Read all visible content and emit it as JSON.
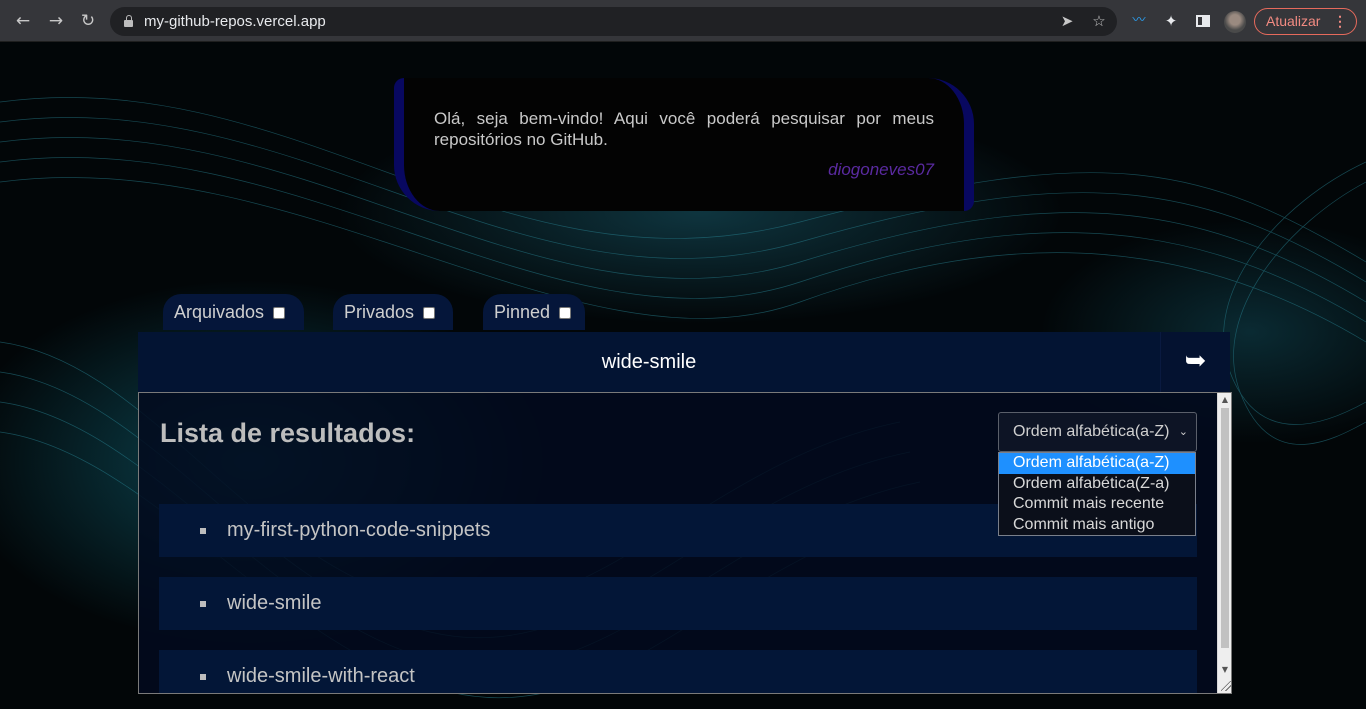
{
  "browser": {
    "url": "my-github-repos.vercel.app",
    "update_label": "Atualizar",
    "update_menu": "⋮"
  },
  "welcome": {
    "text": "Olá, seja bem-vindo! Aqui você poderá pesquisar por meus repositórios no GitHub.",
    "signature": "diogoneves07"
  },
  "filters": {
    "archived": {
      "label": "Arquivados",
      "checked": false
    },
    "private": {
      "label": "Privados",
      "checked": false
    },
    "pinned": {
      "label": "Pinned",
      "checked": false
    }
  },
  "search": {
    "value": "wide-smile",
    "button_icon": "➥"
  },
  "results": {
    "title": "Lista de resultados:",
    "sort_selected": "Ordem alfabética(a-Z)",
    "sort_options": [
      "Ordem alfabética(a-Z)",
      "Ordem alfabética(Z-a)",
      "Commit mais recente",
      "Commit mais antigo"
    ],
    "items": [
      "my-first-python-code-snippets",
      "wide-smile",
      "wide-smile-with-react"
    ]
  },
  "colors": {
    "accent_purple": "#5a2aa0",
    "panel_blue": "#031637",
    "option_highlight": "#1e90ff"
  }
}
